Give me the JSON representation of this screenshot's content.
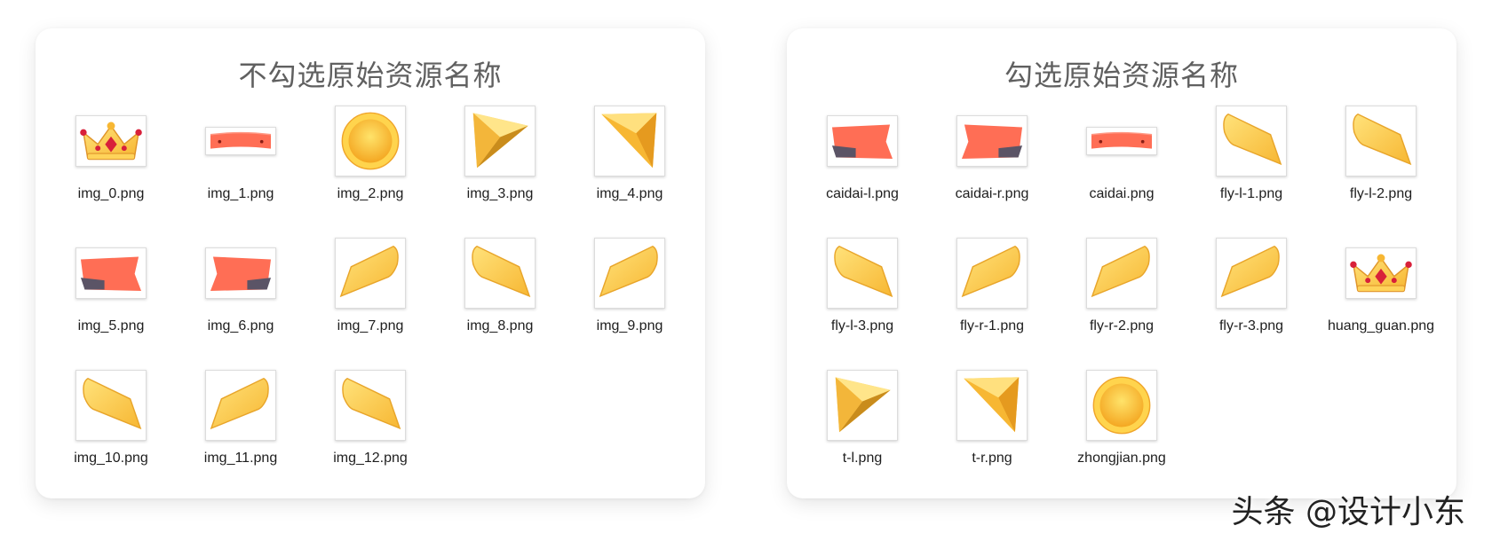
{
  "panels": [
    {
      "title": "不勾选原始资源名称",
      "files": [
        {
          "name": "img_0.png",
          "icon": "crown-icon"
        },
        {
          "name": "img_1.png",
          "icon": "ribbon-icon"
        },
        {
          "name": "img_2.png",
          "icon": "gold-coin-icon"
        },
        {
          "name": "img_3.png",
          "icon": "triangle-left-icon"
        },
        {
          "name": "img_4.png",
          "icon": "triangle-right-icon"
        },
        {
          "name": "img_5.png",
          "icon": "ribbon-end-left-icon"
        },
        {
          "name": "img_6.png",
          "icon": "ribbon-end-right-icon"
        },
        {
          "name": "img_7.png",
          "icon": "wing-right-icon"
        },
        {
          "name": "img_8.png",
          "icon": "wing-left-icon"
        },
        {
          "name": "img_9.png",
          "icon": "wing-right-icon"
        },
        {
          "name": "img_10.png",
          "icon": "wing-left-icon"
        },
        {
          "name": "img_11.png",
          "icon": "wing-right-icon"
        },
        {
          "name": "img_12.png",
          "icon": "wing-left-icon"
        }
      ]
    },
    {
      "title": "勾选原始资源名称",
      "files": [
        {
          "name": "caidai-l.png",
          "icon": "ribbon-end-left-icon"
        },
        {
          "name": "caidai-r.png",
          "icon": "ribbon-end-right-icon"
        },
        {
          "name": "caidai.png",
          "icon": "ribbon-icon"
        },
        {
          "name": "fly-l-1.png",
          "icon": "wing-left-icon"
        },
        {
          "name": "fly-l-2.png",
          "icon": "wing-left-icon"
        },
        {
          "name": "fly-l-3.png",
          "icon": "wing-left-icon"
        },
        {
          "name": "fly-r-1.png",
          "icon": "wing-right-icon"
        },
        {
          "name": "fly-r-2.png",
          "icon": "wing-right-icon"
        },
        {
          "name": "fly-r-3.png",
          "icon": "wing-right-icon"
        },
        {
          "name": "huang_guan.png",
          "icon": "crown-icon"
        },
        {
          "name": "t-l.png",
          "icon": "triangle-left-icon"
        },
        {
          "name": "t-r.png",
          "icon": "triangle-right-icon"
        },
        {
          "name": "zhongjian.png",
          "icon": "gold-coin-icon"
        }
      ]
    }
  ],
  "watermark": "头条 @设计小东",
  "colors": {
    "gold": "#f7b733",
    "gold_light": "#ffe27a",
    "ribbon": "#ff6e55",
    "ribbon_dark": "#5b5466",
    "jewel": "#d8203a",
    "title_text": "#606060"
  }
}
